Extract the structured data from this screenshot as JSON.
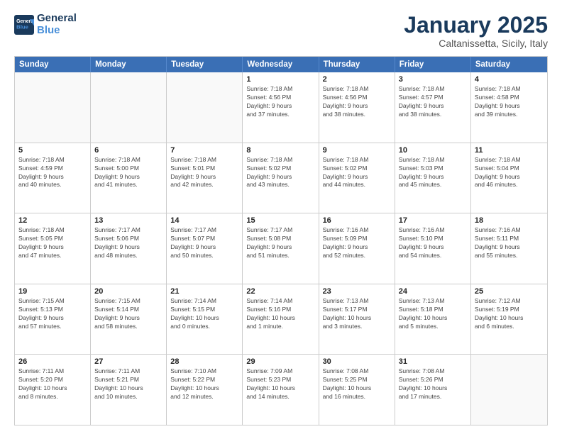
{
  "header": {
    "logo_line1": "General",
    "logo_line2": "Blue",
    "title": "January 2025",
    "subtitle": "Caltanissetta, Sicily, Italy"
  },
  "days_of_week": [
    "Sunday",
    "Monday",
    "Tuesday",
    "Wednesday",
    "Thursday",
    "Friday",
    "Saturday"
  ],
  "weeks": [
    [
      {
        "day": "",
        "info": ""
      },
      {
        "day": "",
        "info": ""
      },
      {
        "day": "",
        "info": ""
      },
      {
        "day": "1",
        "info": "Sunrise: 7:18 AM\nSunset: 4:56 PM\nDaylight: 9 hours\nand 37 minutes."
      },
      {
        "day": "2",
        "info": "Sunrise: 7:18 AM\nSunset: 4:56 PM\nDaylight: 9 hours\nand 38 minutes."
      },
      {
        "day": "3",
        "info": "Sunrise: 7:18 AM\nSunset: 4:57 PM\nDaylight: 9 hours\nand 38 minutes."
      },
      {
        "day": "4",
        "info": "Sunrise: 7:18 AM\nSunset: 4:58 PM\nDaylight: 9 hours\nand 39 minutes."
      }
    ],
    [
      {
        "day": "5",
        "info": "Sunrise: 7:18 AM\nSunset: 4:59 PM\nDaylight: 9 hours\nand 40 minutes."
      },
      {
        "day": "6",
        "info": "Sunrise: 7:18 AM\nSunset: 5:00 PM\nDaylight: 9 hours\nand 41 minutes."
      },
      {
        "day": "7",
        "info": "Sunrise: 7:18 AM\nSunset: 5:01 PM\nDaylight: 9 hours\nand 42 minutes."
      },
      {
        "day": "8",
        "info": "Sunrise: 7:18 AM\nSunset: 5:02 PM\nDaylight: 9 hours\nand 43 minutes."
      },
      {
        "day": "9",
        "info": "Sunrise: 7:18 AM\nSunset: 5:02 PM\nDaylight: 9 hours\nand 44 minutes."
      },
      {
        "day": "10",
        "info": "Sunrise: 7:18 AM\nSunset: 5:03 PM\nDaylight: 9 hours\nand 45 minutes."
      },
      {
        "day": "11",
        "info": "Sunrise: 7:18 AM\nSunset: 5:04 PM\nDaylight: 9 hours\nand 46 minutes."
      }
    ],
    [
      {
        "day": "12",
        "info": "Sunrise: 7:18 AM\nSunset: 5:05 PM\nDaylight: 9 hours\nand 47 minutes."
      },
      {
        "day": "13",
        "info": "Sunrise: 7:17 AM\nSunset: 5:06 PM\nDaylight: 9 hours\nand 48 minutes."
      },
      {
        "day": "14",
        "info": "Sunrise: 7:17 AM\nSunset: 5:07 PM\nDaylight: 9 hours\nand 50 minutes."
      },
      {
        "day": "15",
        "info": "Sunrise: 7:17 AM\nSunset: 5:08 PM\nDaylight: 9 hours\nand 51 minutes."
      },
      {
        "day": "16",
        "info": "Sunrise: 7:16 AM\nSunset: 5:09 PM\nDaylight: 9 hours\nand 52 minutes."
      },
      {
        "day": "17",
        "info": "Sunrise: 7:16 AM\nSunset: 5:10 PM\nDaylight: 9 hours\nand 54 minutes."
      },
      {
        "day": "18",
        "info": "Sunrise: 7:16 AM\nSunset: 5:11 PM\nDaylight: 9 hours\nand 55 minutes."
      }
    ],
    [
      {
        "day": "19",
        "info": "Sunrise: 7:15 AM\nSunset: 5:13 PM\nDaylight: 9 hours\nand 57 minutes."
      },
      {
        "day": "20",
        "info": "Sunrise: 7:15 AM\nSunset: 5:14 PM\nDaylight: 9 hours\nand 58 minutes."
      },
      {
        "day": "21",
        "info": "Sunrise: 7:14 AM\nSunset: 5:15 PM\nDaylight: 10 hours\nand 0 minutes."
      },
      {
        "day": "22",
        "info": "Sunrise: 7:14 AM\nSunset: 5:16 PM\nDaylight: 10 hours\nand 1 minute."
      },
      {
        "day": "23",
        "info": "Sunrise: 7:13 AM\nSunset: 5:17 PM\nDaylight: 10 hours\nand 3 minutes."
      },
      {
        "day": "24",
        "info": "Sunrise: 7:13 AM\nSunset: 5:18 PM\nDaylight: 10 hours\nand 5 minutes."
      },
      {
        "day": "25",
        "info": "Sunrise: 7:12 AM\nSunset: 5:19 PM\nDaylight: 10 hours\nand 6 minutes."
      }
    ],
    [
      {
        "day": "26",
        "info": "Sunrise: 7:11 AM\nSunset: 5:20 PM\nDaylight: 10 hours\nand 8 minutes."
      },
      {
        "day": "27",
        "info": "Sunrise: 7:11 AM\nSunset: 5:21 PM\nDaylight: 10 hours\nand 10 minutes."
      },
      {
        "day": "28",
        "info": "Sunrise: 7:10 AM\nSunset: 5:22 PM\nDaylight: 10 hours\nand 12 minutes."
      },
      {
        "day": "29",
        "info": "Sunrise: 7:09 AM\nSunset: 5:23 PM\nDaylight: 10 hours\nand 14 minutes."
      },
      {
        "day": "30",
        "info": "Sunrise: 7:08 AM\nSunset: 5:25 PM\nDaylight: 10 hours\nand 16 minutes."
      },
      {
        "day": "31",
        "info": "Sunrise: 7:08 AM\nSunset: 5:26 PM\nDaylight: 10 hours\nand 17 minutes."
      },
      {
        "day": "",
        "info": ""
      }
    ]
  ]
}
